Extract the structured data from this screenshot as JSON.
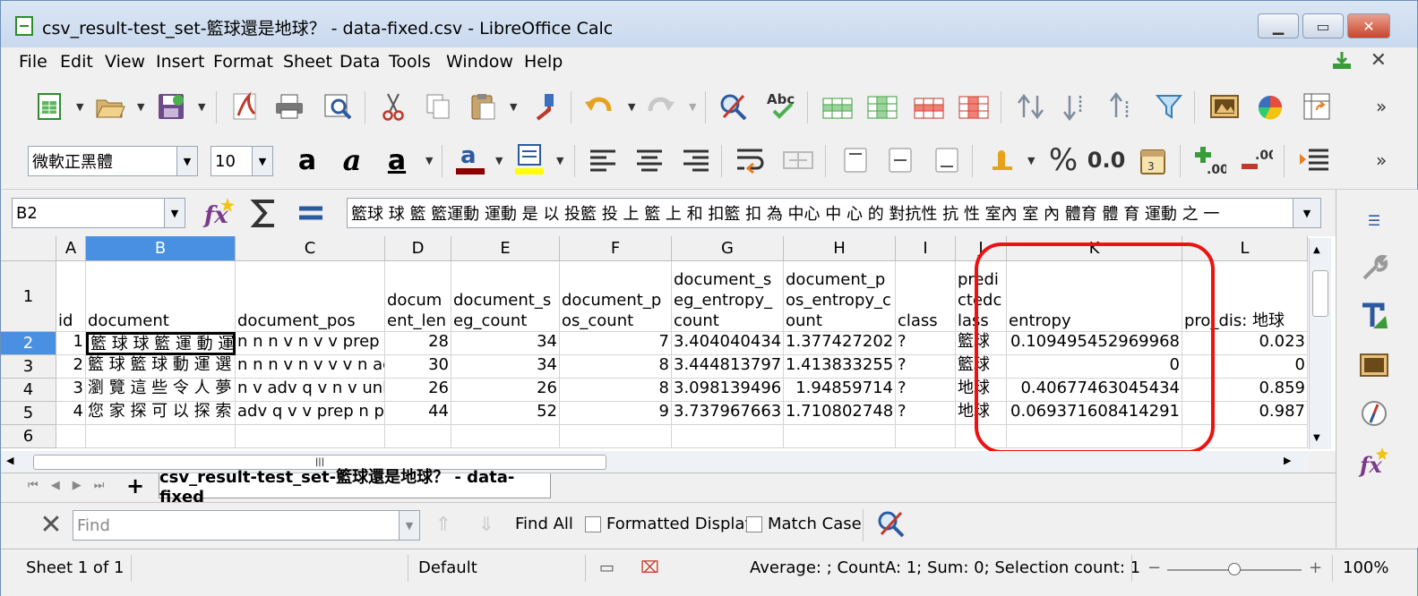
{
  "window": {
    "title": "csv_result-test_set-籃球還是地球？ - data-fixed.csv - LibreOffice Calc",
    "minimize_icon": "minimize-icon",
    "maximize_icon": "maximize-icon",
    "close_icon": "close-icon"
  },
  "menu": {
    "items": [
      {
        "label": "File",
        "key": "F"
      },
      {
        "label": "Edit",
        "key": "E"
      },
      {
        "label": "View",
        "key": "V"
      },
      {
        "label": "Insert",
        "key": "I"
      },
      {
        "label": "Format",
        "key": "o"
      },
      {
        "label": "Sheet",
        "key": "S"
      },
      {
        "label": "Data",
        "key": "D"
      },
      {
        "label": "Tools",
        "key": "T"
      },
      {
        "label": "Window",
        "key": "W"
      },
      {
        "label": "Help",
        "key": "H"
      }
    ],
    "doc_close": "✕"
  },
  "formatting": {
    "font_name": "微軟正黑體",
    "font_size": "10",
    "percent_symbol": "%",
    "number_format": "0.0"
  },
  "formula_bar": {
    "cell_ref": "B2",
    "content": "籃球 球 籃 籃運動 運動 是 以 投籃 投 上 籃 上 和 扣籃 扣 為 中心 中 心 的 對抗性 抗 性 室內 室 內 體育 體 育 運動 之 一"
  },
  "spreadsheet": {
    "columns": [
      "A",
      "B",
      "C",
      "D",
      "E",
      "F",
      "G",
      "H",
      "I",
      "J",
      "K",
      "L"
    ],
    "selected_column": "B",
    "row_numbers": [
      "1",
      "2",
      "3",
      "4",
      "5",
      "6"
    ],
    "selected_row": "2",
    "header_row": [
      "id",
      "document",
      "document_pos",
      "document_len",
      "document_seg_count",
      "document_pos_count",
      "document_seg_entropy_count",
      "document_pos_entropy_count",
      "class",
      "predictedclass",
      "entropy",
      "pro_dis: 地球"
    ],
    "data_rows": [
      [
        "1",
        "籃 球 球 籃 運 動 運",
        "n n n v n v v prep ",
        "28",
        "34",
        "7",
        "3.404040434",
        "1.377427202",
        "?",
        "籃球",
        "0.109495452969968",
        "0.023"
      ],
      [
        "2",
        "籃 球 籃 球 動 運 選",
        "n n n v n v v v n adv",
        "30",
        "34",
        "8",
        "3.444813797",
        "1.413833255",
        "?",
        "籃球",
        "0",
        "0"
      ],
      [
        "3",
        "瀏 覽 這 些 令 人 夢",
        "n v adv q v n v unl",
        "26",
        "26",
        "8",
        "3.098139496",
        "1.94859714",
        "?",
        "地球",
        "0.40677463045434",
        "0.859"
      ],
      [
        "4",
        "您 家 探 可 以 探 索",
        "adv q v v prep n pr",
        "44",
        "52",
        "9",
        "3.737967663",
        "1.710802748",
        "?",
        "地球",
        "0.069371608414291",
        "0.987"
      ]
    ]
  },
  "sheet_tabs": {
    "add_label": "+",
    "active_tab": "csv_result-test_set-籃球還是地球？ - data-fixed"
  },
  "find_bar": {
    "placeholder": "Find",
    "find_all": "Find All",
    "formatted_display": "Formatted Display",
    "formatted_display_key": "F",
    "match_case": "Match Case",
    "match_case_key": "M"
  },
  "status_bar": {
    "sheet": "Sheet 1 of 1",
    "page_style": "Default",
    "summary": "Average: ; CountA: 1; Sum: 0; Selection count: 1",
    "zoom": "100%",
    "zoom_minus": "−",
    "zoom_plus": "+"
  },
  "colors": {
    "selection": "#4a90e2",
    "highlight_box": "#ee1111",
    "title_gradient": "#c9d9ee"
  }
}
